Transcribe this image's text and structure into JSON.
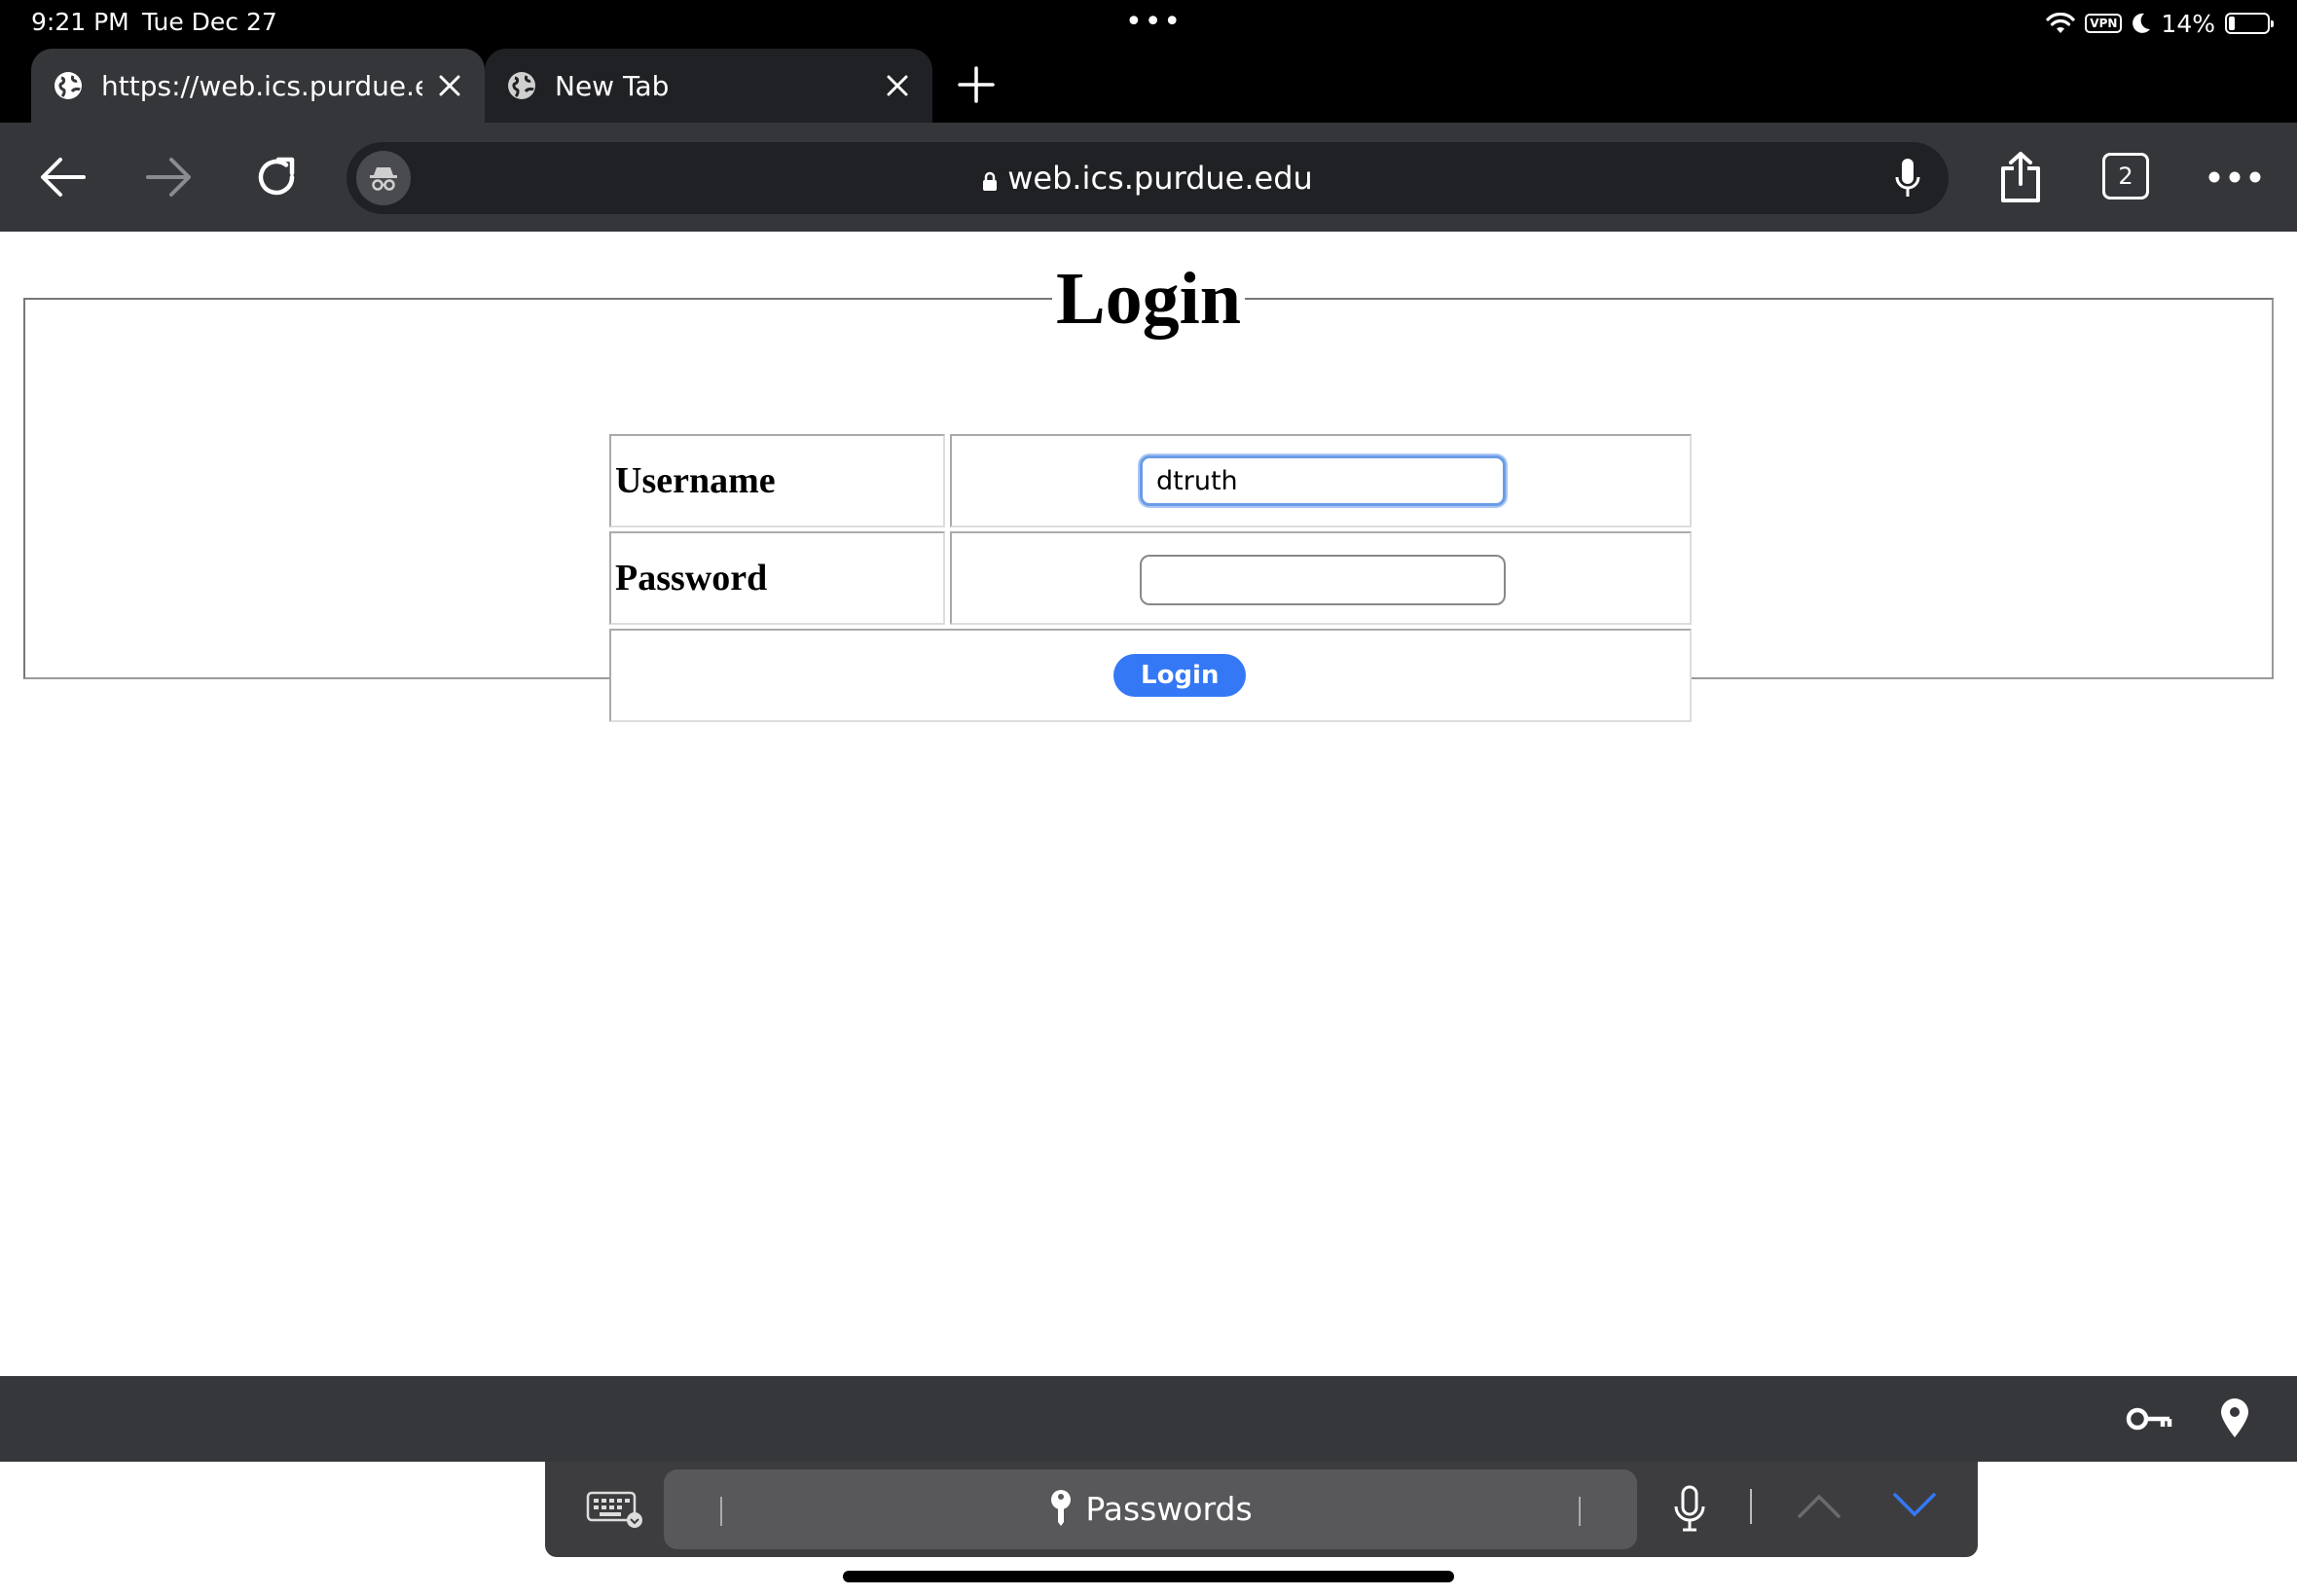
{
  "status_bar": {
    "time": "9:21 PM",
    "date": "Tue Dec 27",
    "multitasking_dots": "•••",
    "vpn": "VPN",
    "battery": "14%"
  },
  "tabs": [
    {
      "title": "https://web.ics.purdue.edu",
      "active": true
    },
    {
      "title": "New Tab",
      "active": false
    }
  ],
  "toolbar": {
    "url": "web.ics.purdue.edu",
    "tab_count": "2"
  },
  "page": {
    "title": "Login",
    "username_label": "Username",
    "username_value": "dtruth",
    "password_label": "Password",
    "password_value": "",
    "login_button": "Login"
  },
  "keyboard_bar": {
    "passwords_label": "Passwords"
  },
  "colors": {
    "accent": "#3478f6",
    "toolbar": "#35363a",
    "omnibox": "#202124"
  }
}
